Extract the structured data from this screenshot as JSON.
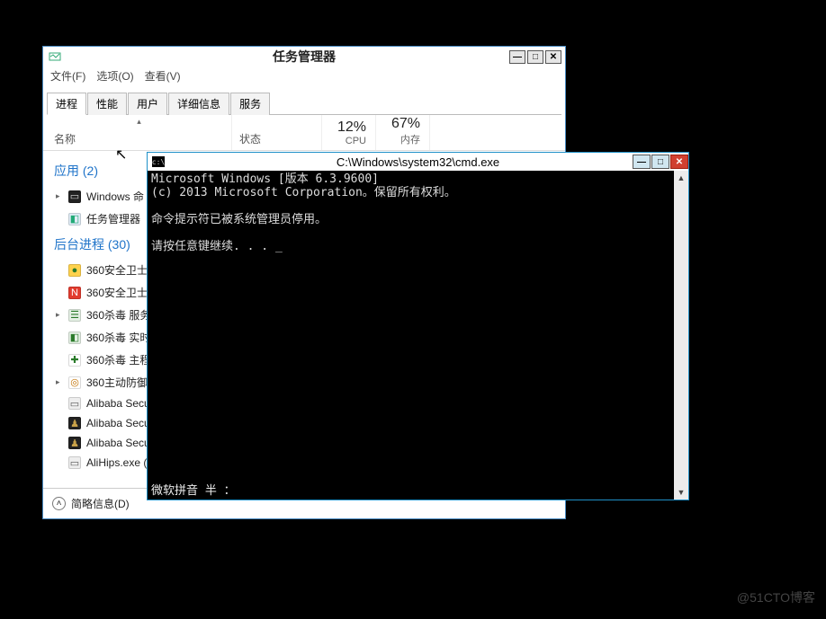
{
  "taskmgr": {
    "title": "任务管理器",
    "menus": [
      "文件(F)",
      "选项(O)",
      "查看(V)"
    ],
    "tabs": [
      "进程",
      "性能",
      "用户",
      "详细信息",
      "服务"
    ],
    "active_tab_index": 0,
    "columns": {
      "name": "名称",
      "status": "状态"
    },
    "metrics": [
      {
        "value": "12%",
        "label": "CPU"
      },
      {
        "value": "67%",
        "label": "内存"
      }
    ],
    "groups": [
      {
        "label": "应用 (2)",
        "items": [
          {
            "expand": "▸",
            "icon_bg": "#222",
            "icon_fg": "#ddd",
            "glyph": "▭",
            "name": "Windows 命"
          },
          {
            "expand": "",
            "icon_bg": "#e0ecf6",
            "icon_fg": "#2a7",
            "glyph": "◧",
            "name": "任务管理器"
          }
        ]
      },
      {
        "label": "后台进程 (30)",
        "items": [
          {
            "expand": "",
            "icon_bg": "#ffd24d",
            "icon_fg": "#2a7a2a",
            "glyph": "●",
            "name": "360安全卫士"
          },
          {
            "expand": "",
            "icon_bg": "#e23b2e",
            "icon_fg": "#fff",
            "glyph": "N",
            "name": "360安全卫士"
          },
          {
            "expand": "▸",
            "icon_bg": "#e4f0e4",
            "icon_fg": "#2a7a2a",
            "glyph": "☰",
            "name": "360杀毒 服务"
          },
          {
            "expand": "",
            "icon_bg": "#e4f0e4",
            "icon_fg": "#2a7a2a",
            "glyph": "◧",
            "name": "360杀毒 实时"
          },
          {
            "expand": "",
            "icon_bg": "#fff",
            "icon_fg": "#2a7a2a",
            "glyph": "✚",
            "name": "360杀毒 主程"
          },
          {
            "expand": "▸",
            "icon_bg": "#fff",
            "icon_fg": "#c07000",
            "glyph": "◎",
            "name": "360主动防御"
          },
          {
            "expand": "",
            "icon_bg": "#eee",
            "icon_fg": "#555",
            "glyph": "▭",
            "name": "Alibaba Secu"
          },
          {
            "expand": "",
            "icon_bg": "#222",
            "icon_fg": "#c9a24a",
            "glyph": "♟",
            "name": "Alibaba Secu"
          },
          {
            "expand": "",
            "icon_bg": "#222",
            "icon_fg": "#c9a24a",
            "glyph": "♟",
            "name": "Alibaba Secu"
          },
          {
            "expand": "",
            "icon_bg": "#eee",
            "icon_fg": "#555",
            "glyph": "▭",
            "name": "AliHips.exe ("
          }
        ]
      }
    ],
    "footer_toggle": "简略信息(D)",
    "window_controls": {
      "min": "—",
      "max": "□",
      "close": "✕"
    }
  },
  "cmd": {
    "title": "C:\\Windows\\system32\\cmd.exe",
    "lines": [
      "Microsoft Windows [版本 6.3.9600]",
      "(c) 2013 Microsoft Corporation。保留所有权利。",
      "",
      "命令提示符已被系统管理员停用。",
      "",
      "请按任意键继续. . . _"
    ],
    "ime_status": "微软拼音 半 ：",
    "window_controls": {
      "min": "—",
      "max": "□",
      "close": "✕"
    }
  },
  "watermark": "@51CTO博客"
}
